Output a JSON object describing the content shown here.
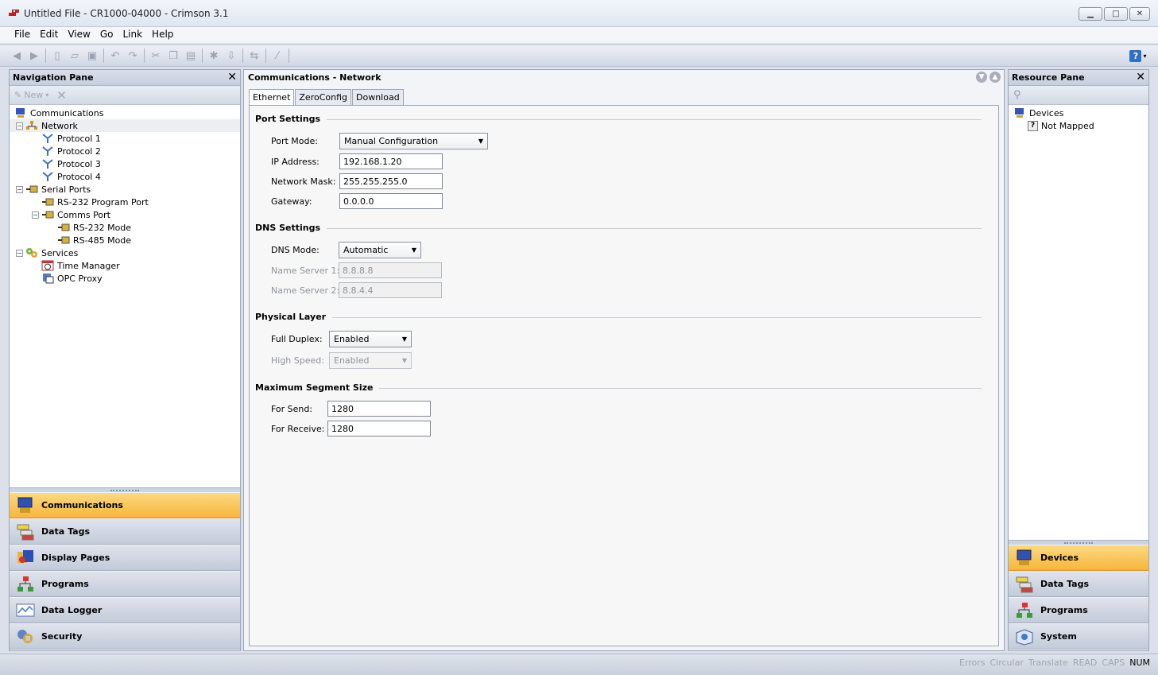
{
  "window": {
    "title": "Untitled File - CR1000-04000 - Crimson 3.1"
  },
  "menu": [
    "File",
    "Edit",
    "View",
    "Go",
    "Link",
    "Help"
  ],
  "nav_pane": {
    "title": "Navigation Pane",
    "new_label": "New",
    "tree": [
      {
        "label": "Communications",
        "level": 0,
        "expander": "",
        "icon": "communications-icon"
      },
      {
        "label": "Network",
        "level": 1,
        "expander": "−",
        "icon": "network-icon",
        "selected": true
      },
      {
        "label": "Protocol 1",
        "level": 2,
        "expander": "",
        "icon": "protocol-icon"
      },
      {
        "label": "Protocol 2",
        "level": 2,
        "expander": "",
        "icon": "protocol-icon"
      },
      {
        "label": "Protocol 3",
        "level": 2,
        "expander": "",
        "icon": "protocol-icon"
      },
      {
        "label": "Protocol 4",
        "level": 2,
        "expander": "",
        "icon": "protocol-icon"
      },
      {
        "label": "Serial Ports",
        "level": 1,
        "expander": "−",
        "icon": "serial-port-icon"
      },
      {
        "label": "RS-232 Program Port",
        "level": 2,
        "expander": "",
        "icon": "serial-port-icon"
      },
      {
        "label": "Comms Port",
        "level": 2,
        "expander": "−",
        "icon": "serial-port-icon"
      },
      {
        "label": "RS-232 Mode",
        "level": 3,
        "expander": "",
        "icon": "serial-port-icon"
      },
      {
        "label": "RS-485 Mode",
        "level": 3,
        "expander": "",
        "icon": "serial-port-icon"
      },
      {
        "label": "Services",
        "level": 1,
        "expander": "−",
        "icon": "services-icon"
      },
      {
        "label": "Time Manager",
        "level": 2,
        "expander": "",
        "icon": "time-manager-icon"
      },
      {
        "label": "OPC Proxy",
        "level": 2,
        "expander": "",
        "icon": "opc-proxy-icon"
      }
    ],
    "categories": [
      {
        "label": "Communications",
        "icon": "communications-icon",
        "active": true
      },
      {
        "label": "Data Tags",
        "icon": "data-tags-icon",
        "active": false
      },
      {
        "label": "Display Pages",
        "icon": "display-pages-icon",
        "active": false
      },
      {
        "label": "Programs",
        "icon": "programs-icon",
        "active": false
      },
      {
        "label": "Data Logger",
        "icon": "data-logger-icon",
        "active": false
      },
      {
        "label": "Security",
        "icon": "security-icon",
        "active": false
      }
    ]
  },
  "main": {
    "title": "Communications - Network",
    "tabs": [
      {
        "label": "Ethernet",
        "active": true
      },
      {
        "label": "ZeroConfig",
        "active": false
      },
      {
        "label": "Download",
        "active": false
      }
    ],
    "port_settings": {
      "heading": "Port Settings",
      "port_mode_label": "Port Mode:",
      "port_mode_value": "Manual Configuration",
      "ip_label": "IP Address:",
      "ip_value": "192.168.1.20",
      "mask_label": "Network Mask:",
      "mask_value": "255.255.255.0",
      "gateway_label": "Gateway:",
      "gateway_value": "0.0.0.0"
    },
    "dns_settings": {
      "heading": "DNS Settings",
      "mode_label": "DNS Mode:",
      "mode_value": "Automatic",
      "ns1_label": "Name Server 1:",
      "ns1_value": "8.8.8.8",
      "ns2_label": "Name Server 2:",
      "ns2_value": "8.8.4.4"
    },
    "physical_layer": {
      "heading": "Physical Layer",
      "duplex_label": "Full Duplex:",
      "duplex_value": "Enabled",
      "speed_label": "High Speed:",
      "speed_value": "Enabled"
    },
    "mss": {
      "heading": "Maximum Segment Size",
      "send_label": "For Send:",
      "send_value": "1280",
      "recv_label": "For Receive:",
      "recv_value": "1280"
    }
  },
  "resource_pane": {
    "title": "Resource Pane",
    "tree": [
      {
        "label": "Devices",
        "level": 0,
        "icon": "devices-icon"
      },
      {
        "label": "Not Mapped",
        "level": 1,
        "icon": "question-icon"
      }
    ],
    "categories": [
      {
        "label": "Devices",
        "icon": "devices-icon",
        "active": true
      },
      {
        "label": "Data Tags",
        "icon": "data-tags-icon",
        "active": false
      },
      {
        "label": "Programs",
        "icon": "programs-icon",
        "active": false
      },
      {
        "label": "System",
        "icon": "system-icon",
        "active": false
      }
    ]
  },
  "statusbar": [
    {
      "label": "Errors",
      "on": false
    },
    {
      "label": "Circular",
      "on": false
    },
    {
      "label": "Translate",
      "on": false
    },
    {
      "label": "READ",
      "on": false
    },
    {
      "label": "CAPS",
      "on": false
    },
    {
      "label": "NUM",
      "on": true
    }
  ],
  "colors": {
    "active_category": "#f6b63c",
    "pane_header": "#c6cfde"
  }
}
